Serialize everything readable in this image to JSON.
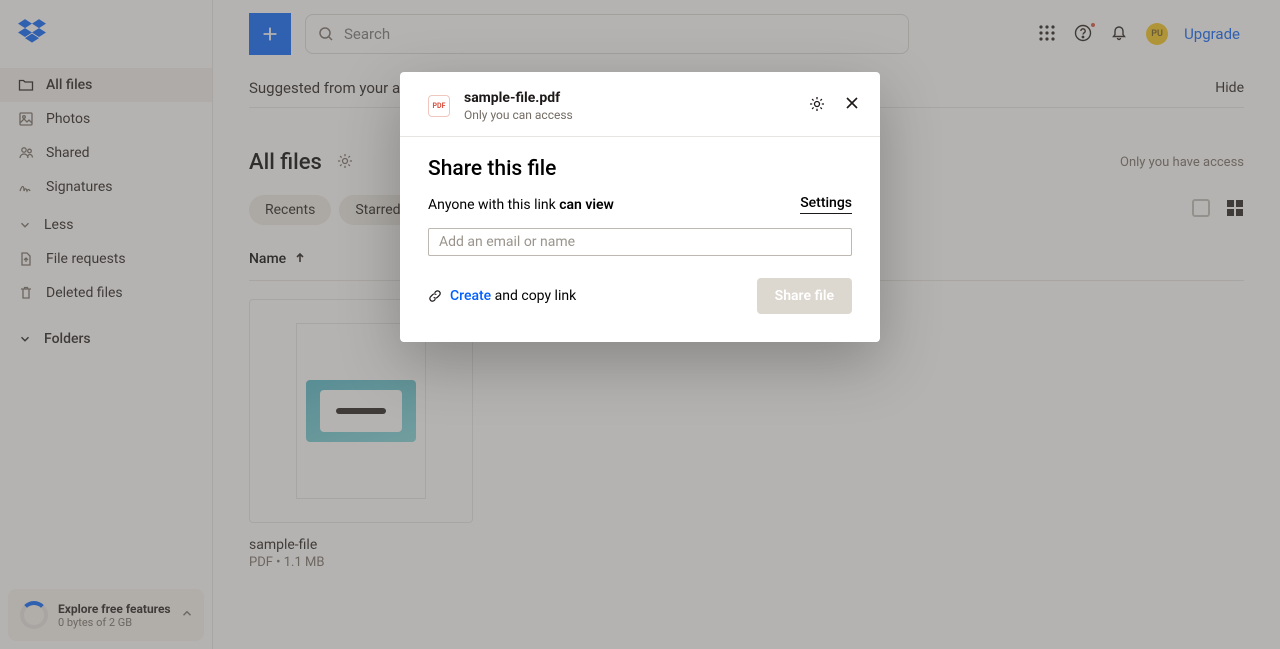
{
  "sidebar": {
    "items": [
      {
        "label": "All files"
      },
      {
        "label": "Photos"
      },
      {
        "label": "Shared"
      },
      {
        "label": "Signatures"
      },
      {
        "label": "Less"
      },
      {
        "label": "File requests"
      },
      {
        "label": "Deleted files"
      }
    ],
    "folders_label": "Folders",
    "storage_title": "Explore free features",
    "storage_sub": "0 bytes of 2 GB"
  },
  "header": {
    "search_placeholder": "Search",
    "avatar_initials": "PU",
    "upgrade_label": "Upgrade"
  },
  "content": {
    "suggested_title": "Suggested from your activity",
    "hide_label": "Hide",
    "allfiles_title": "All files",
    "access_text": "Only you have access",
    "pill_recents": "Recents",
    "pill_starred": "Starred",
    "col_name": "Name",
    "file_name": "sample-file",
    "file_meta": "PDF • 1.1 MB"
  },
  "modal": {
    "pdf_badge": "PDF",
    "file_name": "sample-file.pdf",
    "file_sub": "Only you can access",
    "title": "Share this file",
    "link_prefix": "Anyone with this link ",
    "link_bold": "can view",
    "settings_label": "Settings",
    "email_placeholder": "Add an email or name",
    "create_word": "Create",
    "create_rest": " and copy link",
    "share_btn": "Share file"
  }
}
